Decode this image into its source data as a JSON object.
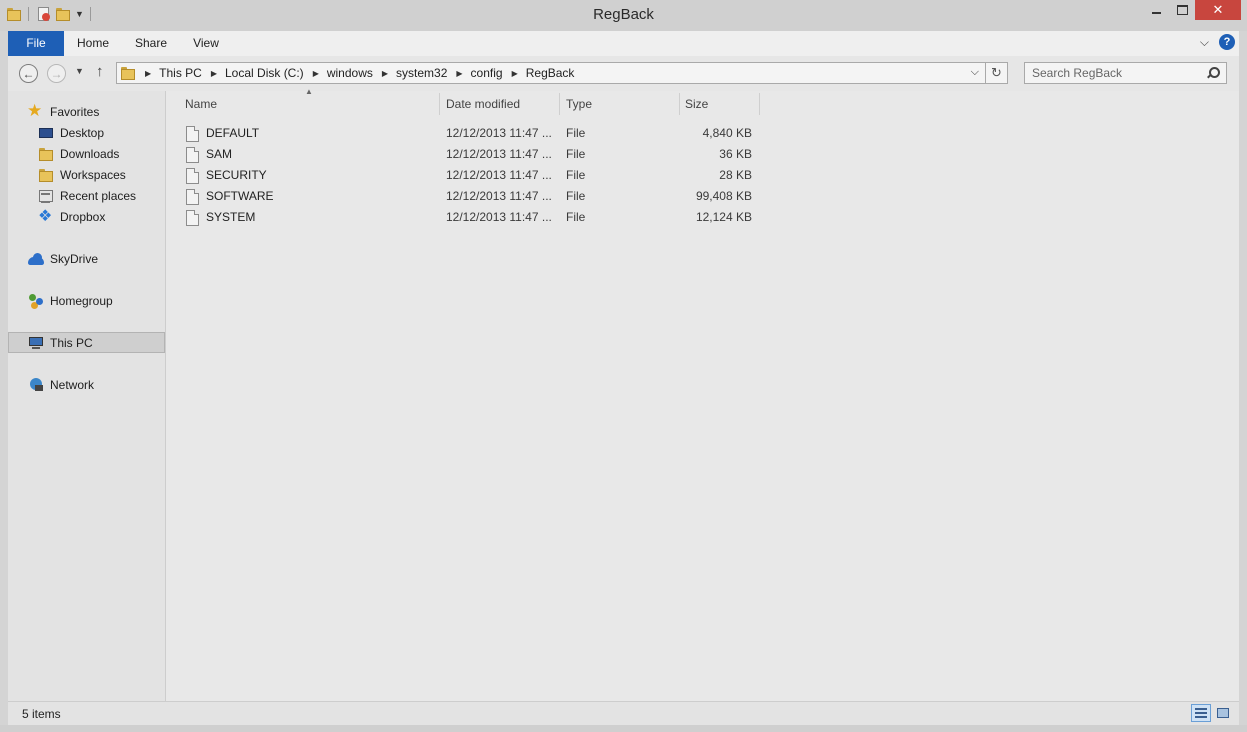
{
  "window": {
    "title": "RegBack"
  },
  "ribbon": {
    "tabs": [
      "File",
      "Home",
      "Share",
      "View"
    ]
  },
  "address": {
    "crumbs": [
      "This PC",
      "Local Disk (C:)",
      "windows",
      "system32",
      "config",
      "RegBack"
    ]
  },
  "search": {
    "placeholder": "Search RegBack"
  },
  "nav_pane": {
    "favorites": {
      "label": "Favorites",
      "items": [
        "Desktop",
        "Downloads",
        "Workspaces",
        "Recent places",
        "Dropbox"
      ]
    },
    "skydrive": "SkyDrive",
    "homegroup": "Homegroup",
    "this_pc": "This PC",
    "network": "Network"
  },
  "columns": {
    "name": "Name",
    "date": "Date modified",
    "type": "Type",
    "size": "Size"
  },
  "files": [
    {
      "name": "DEFAULT",
      "date": "12/12/2013 11:47 ...",
      "type": "File",
      "size": "4,840 KB"
    },
    {
      "name": "SAM",
      "date": "12/12/2013 11:47 ...",
      "type": "File",
      "size": "36 KB"
    },
    {
      "name": "SECURITY",
      "date": "12/12/2013 11:47 ...",
      "type": "File",
      "size": "28 KB"
    },
    {
      "name": "SOFTWARE",
      "date": "12/12/2013 11:47 ...",
      "type": "File",
      "size": "99,408 KB"
    },
    {
      "name": "SYSTEM",
      "date": "12/12/2013 11:47 ...",
      "type": "File",
      "size": "12,124 KB"
    }
  ],
  "status": {
    "count": "5 items"
  },
  "colors": {
    "file_tab": "#1e5fb6",
    "close_button": "#c8463e"
  }
}
